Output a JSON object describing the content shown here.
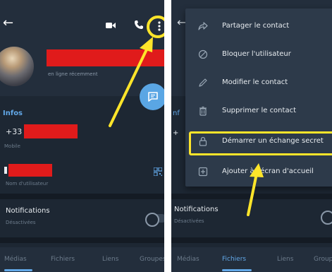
{
  "left_screen": {
    "status_text": "en ligne récemment",
    "section_title": "Infos",
    "phone_prefix": "+33 6",
    "phone_label": "Mobile",
    "username_label": "Nom d'utilisateur",
    "notifications_title": "Notifications",
    "notifications_status": "Désactivées",
    "tabs": [
      {
        "label": "Médias",
        "active": true
      },
      {
        "label": "Fichiers",
        "active": false
      },
      {
        "label": "Liens",
        "active": false
      },
      {
        "label": "Groupes",
        "active": false
      }
    ]
  },
  "right_screen": {
    "menu_items": [
      {
        "label": "Partager le contact",
        "icon": "share-icon"
      },
      {
        "label": "Bloquer l'utilisateur",
        "icon": "block-icon"
      },
      {
        "label": "Modifier le contact",
        "icon": "edit-icon"
      },
      {
        "label": "Supprimer le contact",
        "icon": "trash-icon"
      },
      {
        "label": "Démarrer un échange secret",
        "icon": "lock-icon"
      },
      {
        "label": "Ajouter à l'écran d'accueil",
        "icon": "add-home-icon"
      }
    ],
    "notifications_title": "Notifications",
    "notifications_status": "Désactivées",
    "tabs": [
      {
        "label": "Médias",
        "active": false
      },
      {
        "label": "Fichiers",
        "active": true
      },
      {
        "label": "Liens",
        "active": false
      },
      {
        "label": "Groupes",
        "active": false
      }
    ]
  },
  "colors": {
    "background": "#1d2733",
    "header": "#232e3c",
    "menu": "#2d3a4a",
    "accent": "#62a8e8",
    "highlight": "#ffe52a",
    "redaction": "#e01b1b"
  }
}
